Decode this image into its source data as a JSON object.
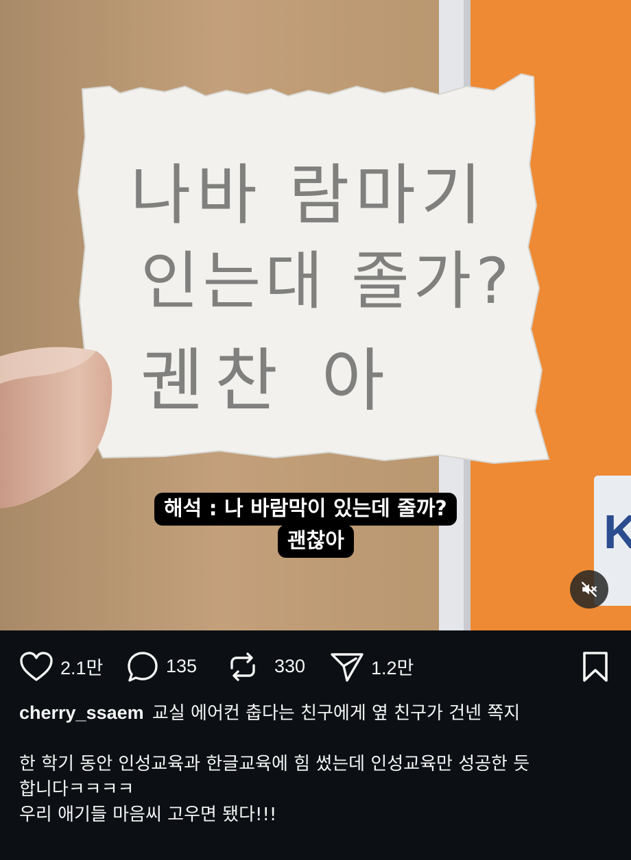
{
  "media": {
    "note_handwriting_lines": [
      "나바 람마기",
      "인는대 졸가?",
      "궨찬 아"
    ],
    "caption_overlay": {
      "line1": "해석 : 나 바람막이 있는데 줄까?",
      "line2": "괜찮아"
    },
    "mute_icon": "speaker-muted-icon"
  },
  "actions": {
    "like_count": "2.1만",
    "comment_count": "135",
    "repost_count": "330",
    "share_count": "1.2만",
    "icons": [
      "heart-icon",
      "comment-icon",
      "repost-icon",
      "send-icon",
      "bookmark-icon"
    ]
  },
  "post": {
    "username": "cherry_ssaem",
    "caption_title": "교실 에어컨 춥다는 친구에게 옆 친구가 건넨 쪽지",
    "body_lines": [
      "한 학기 동안 인성교육과 한글교육에 힘 썼는데 인성교육만 성공한 듯",
      "합니다ㅋㅋㅋㅋ",
      "우리 애기들 마음씨 고우면 됐다!!!"
    ]
  },
  "colors": {
    "background": "#0c1014",
    "text": "#f5f5f5",
    "caption_bg": "#000000",
    "orange_wall": "#ee8a33"
  }
}
